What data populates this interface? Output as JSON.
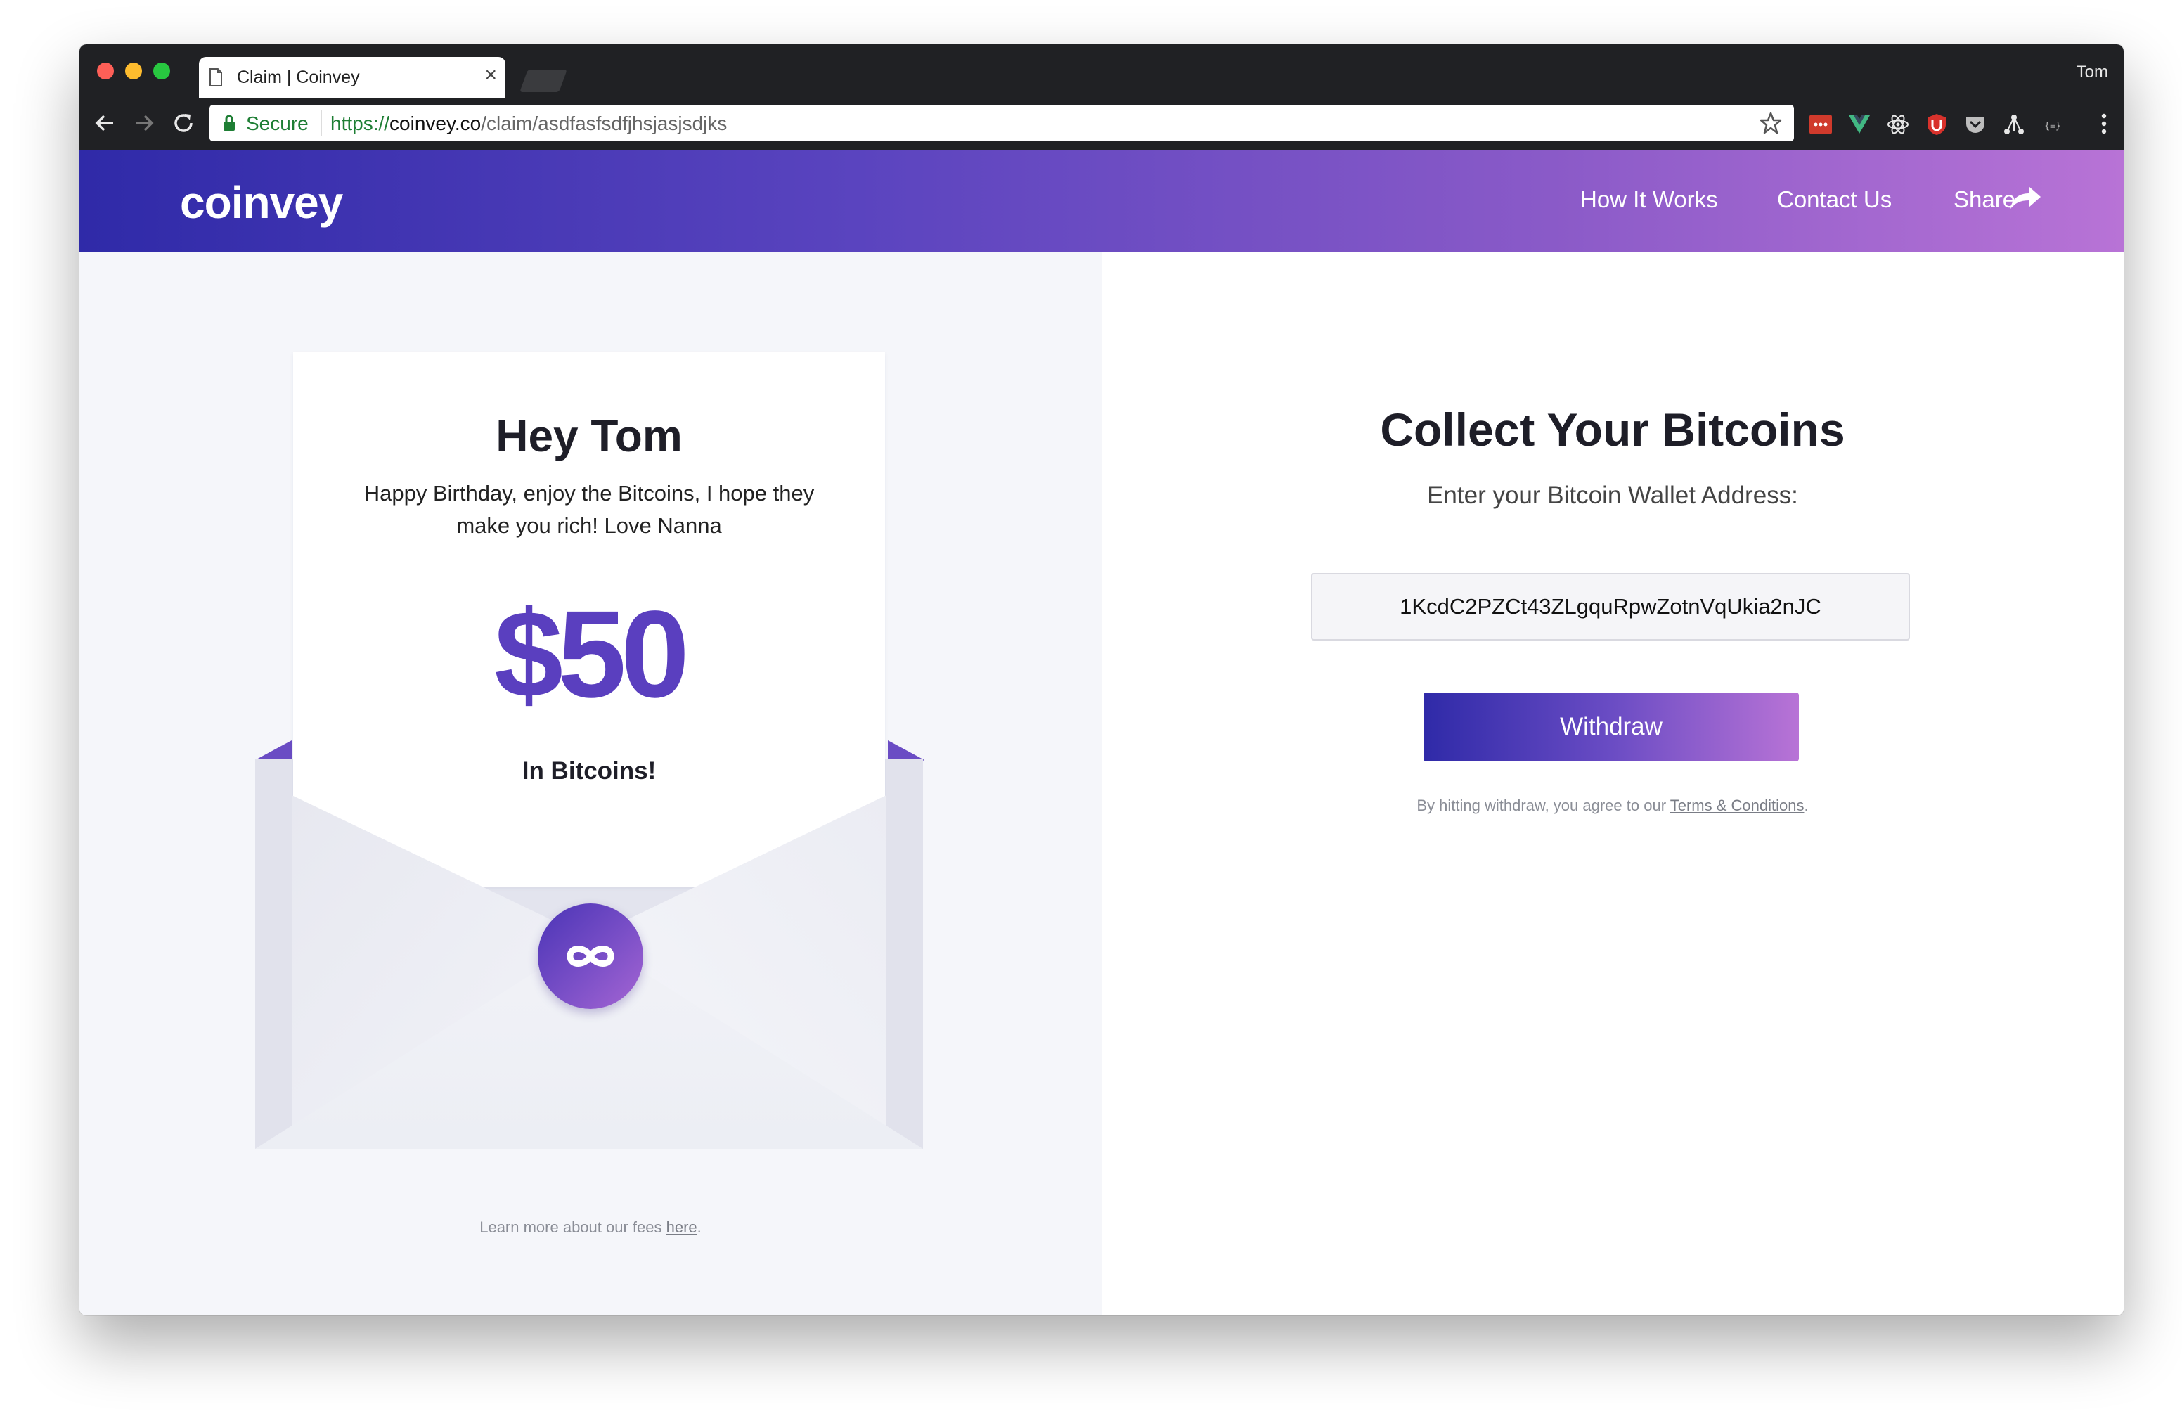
{
  "browser": {
    "tab_title": "Claim | Coinvey",
    "tab_close": "×",
    "profile_name": "Tom",
    "secure_label": "Secure",
    "url_scheme": "https://",
    "url_host": "coinvey.co",
    "url_path": "/claim/asdfasfsdfjhsjasjsdjks",
    "extension_icons": [
      "lastpass-icon",
      "vue-devtools-icon",
      "react-devtools-icon",
      "ublock-icon",
      "pocket-icon",
      "graph-icon",
      "json-icon"
    ]
  },
  "header": {
    "logo": "coinvey",
    "nav": {
      "how_it_works": "How It Works",
      "contact_us": "Contact Us",
      "share": "Share"
    }
  },
  "letter": {
    "greeting": "Hey Tom",
    "message": "Happy Birthday, enjoy the Bitcoins, I hope they make you rich! Love Nanna",
    "amount": "$50",
    "subtitle": "In Bitcoins!"
  },
  "fees": {
    "text": "Learn more about our fees ",
    "link": "here",
    "suffix": "."
  },
  "collect": {
    "title": "Collect Your Bitcoins",
    "subtitle": "Enter your Bitcoin Wallet Address:",
    "wallet_address": "1KcdC2PZCt43ZLgquRpwZotnVqUkia2nJC",
    "withdraw_label": "Withdraw",
    "terms_text": "By hitting withdraw, you agree to our ",
    "terms_link": "Terms & Conditions",
    "terms_suffix": "."
  },
  "colors": {
    "brand_start": "#2f2aa8",
    "brand_end": "#b873d6",
    "amount": "#5a3fbf",
    "secure_green": "#1e7e34"
  }
}
